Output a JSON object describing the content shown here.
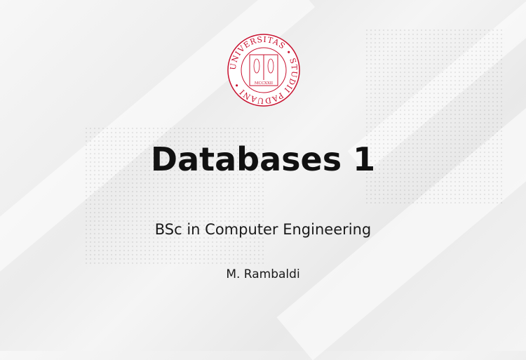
{
  "seal": {
    "text_top": "UNIVERSITAS • STUDII PADUANI •",
    "year": "MCCXXII",
    "color": "#c8102e"
  },
  "title": "Databases 1",
  "subtitle": "BSc in Computer Engineering",
  "author": "M. Rambaldi"
}
